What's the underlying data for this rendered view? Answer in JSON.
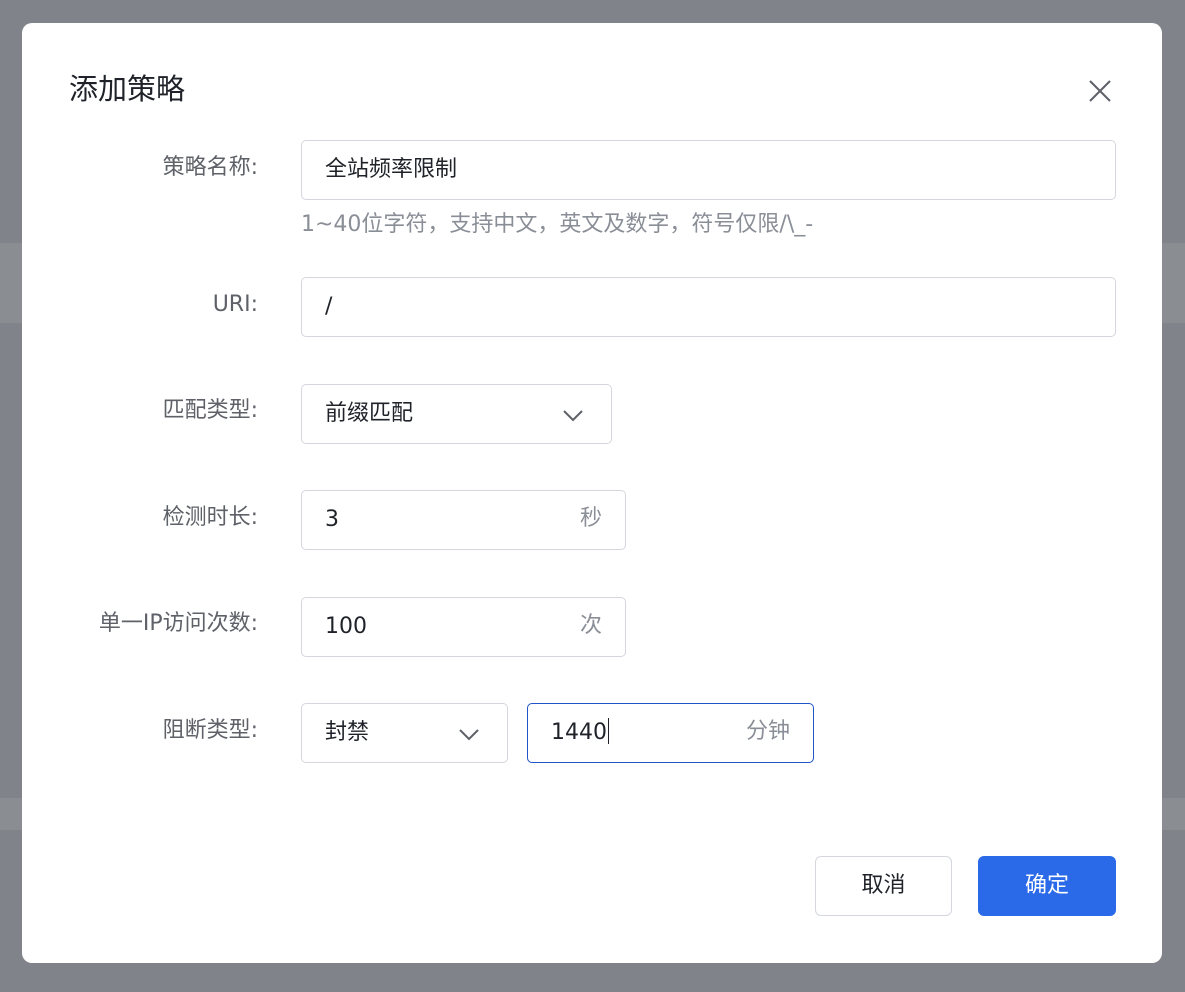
{
  "dialog": {
    "title": "添加策略",
    "close_icon": "close-icon"
  },
  "form": {
    "name": {
      "label": "策略名称:",
      "value": "全站频率限制",
      "hint": "1~40位字符，支持中文，英文及数字，符号仅限/\\_-"
    },
    "uri": {
      "label": "URI:",
      "value": "/"
    },
    "match_type": {
      "label": "匹配类型:",
      "value": "前缀匹配",
      "icon": "chevron-down-icon"
    },
    "duration": {
      "label": "检测时长:",
      "value": "3",
      "unit": "秒"
    },
    "ip_count": {
      "label": "单一IP访问次数:",
      "value": "100",
      "unit": "次"
    },
    "block_type": {
      "label": "阻断类型:",
      "value": "封禁",
      "icon": "chevron-down-icon",
      "duration_value": "1440",
      "duration_unit": "分钟"
    }
  },
  "footer": {
    "cancel_label": "取消",
    "confirm_label": "确定"
  },
  "colors": {
    "primary": "#2a6ae9",
    "focus_border": "#1e55c7",
    "overlay": "#808389"
  }
}
